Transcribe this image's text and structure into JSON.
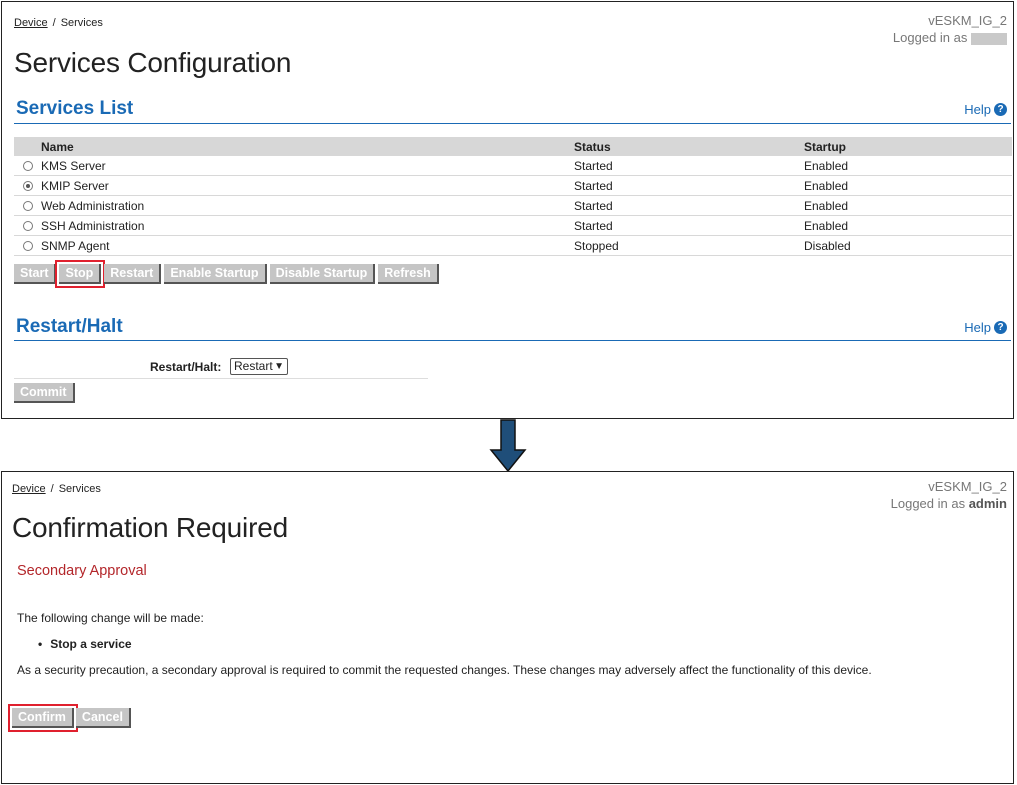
{
  "top_panel": {
    "breadcrumb": {
      "link": "Device",
      "separator": "/",
      "current": "Services"
    },
    "device_name": "vESKM_IG_2",
    "logged_in_prefix": "Logged in as",
    "page_title": "Services Configuration",
    "services_section": {
      "title": "Services List",
      "help": "Help",
      "columns": [
        "Name",
        "Status",
        "Startup"
      ],
      "rows": [
        {
          "name": "KMS Server",
          "status": "Started",
          "startup": "Enabled",
          "selected": false
        },
        {
          "name": "KMIP Server",
          "status": "Started",
          "startup": "Enabled",
          "selected": true
        },
        {
          "name": "Web Administration",
          "status": "Started",
          "startup": "Enabled",
          "selected": false
        },
        {
          "name": "SSH Administration",
          "status": "Started",
          "startup": "Enabled",
          "selected": false
        },
        {
          "name": "SNMP Agent",
          "status": "Stopped",
          "startup": "Disabled",
          "selected": false
        }
      ],
      "buttons": {
        "start": "Start",
        "stop": "Stop",
        "restart": "Restart",
        "enable_startup": "Enable Startup",
        "disable_startup": "Disable Startup",
        "refresh": "Refresh"
      }
    },
    "restart_section": {
      "title": "Restart/Halt",
      "help": "Help",
      "field_label": "Restart/Halt:",
      "selected_option": "Restart",
      "commit": "Commit"
    }
  },
  "bottom_panel": {
    "breadcrumb": {
      "link": "Device",
      "separator": "/",
      "current": "Services"
    },
    "device_name": "vESKM_IG_2",
    "logged_in_prefix": "Logged in as",
    "user": "admin",
    "page_title": "Confirmation Required",
    "subtitle": "Secondary Approval",
    "intro": "The following change will be made:",
    "change_item": "Stop a service",
    "warning": "As a security precaution, a secondary approval is required to commit the requested changes.  These changes may adversely affect the functionality of this device.",
    "buttons": {
      "confirm": "Confirm",
      "cancel": "Cancel"
    }
  },
  "colors": {
    "accent_blue": "#1a6ab5",
    "approval_red": "#b3262a",
    "highlight_red": "#e0202e",
    "arrow_blue": "#1f4e79"
  }
}
